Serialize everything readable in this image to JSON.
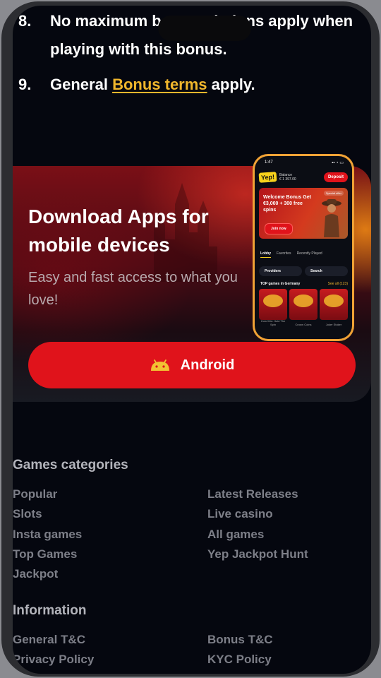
{
  "terms": {
    "item8_num": "8.",
    "item8_line1": "No maximum bet restrictions apply when",
    "item8_line2": "playing with this bonus.",
    "item9_num": "9.",
    "item9_pre": "General",
    "item9_link": "Bonus terms",
    "item9_post": "apply."
  },
  "promo": {
    "title": "Download Apps for mobile devices",
    "subtitle": "Easy and fast access to what you love!",
    "android_label": "Android",
    "android_icon": "android-icon",
    "accent": "#e0131b"
  },
  "phone": {
    "time": "1:47",
    "logo": "Yep!",
    "balance_label": "Balance",
    "balance_value": "€ 1 397.00",
    "deposit": "Deposit",
    "banner_title": "Welcome Bonus Get €3,000 + 300 free spins",
    "special": "Special offer",
    "join": "Join now",
    "tabs": [
      "Lobby",
      "Favorites",
      "Recently Played"
    ],
    "providers": "Providers",
    "search": "Search",
    "top_title": "TOP games in Germany",
    "see_all": "See all (123)",
    "games": [
      "Coin Win: Hold The Spin",
      "Crown Coins",
      "Joker Stoker"
    ]
  },
  "footer": {
    "games_heading": "Games categories",
    "games_left": [
      "Popular",
      "Slots",
      "Insta games",
      "Top Games",
      "Jackpot"
    ],
    "games_right": [
      "Latest Releases",
      "Live casino",
      "All games",
      "Yep Jackpot Hunt"
    ],
    "info_heading": "Information",
    "info_left": [
      "General T&C",
      "Privacy Policy"
    ],
    "info_right": [
      "Bonus T&C",
      "KYC Policy"
    ]
  }
}
